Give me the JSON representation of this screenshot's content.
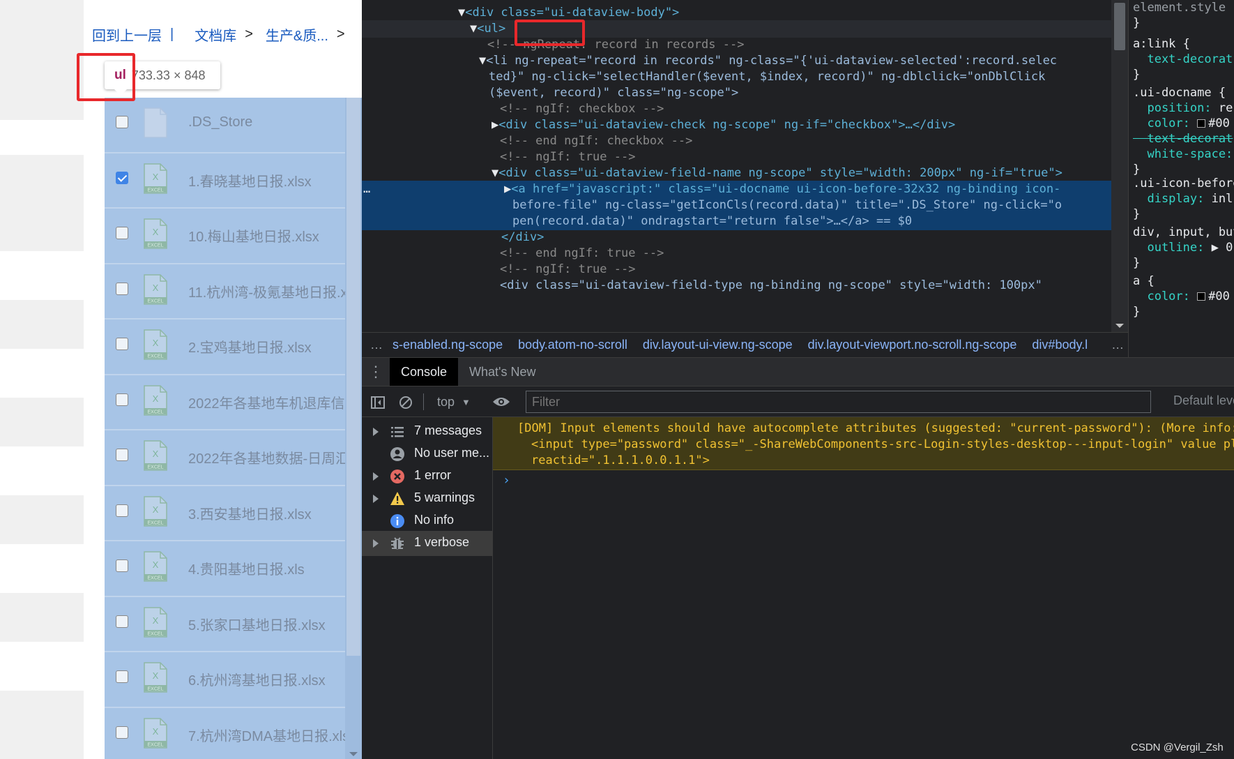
{
  "left_page": {
    "breadcrumb": {
      "back": "回到上一层",
      "pipe": "|",
      "root": "文档库",
      "sep": ">",
      "folder": "生产&质...",
      "sep2": ">"
    },
    "tooltip": {
      "tag": "ul",
      "size": "733.33 × 848"
    },
    "files": [
      {
        "name": ".DS_Store",
        "checked": false,
        "icon": "generic-file-icon"
      },
      {
        "name": "1.春晓基地日报.xlsx",
        "checked": true,
        "icon": "excel-file-icon"
      },
      {
        "name": "10.梅山基地日报.xlsx",
        "checked": false,
        "icon": "excel-file-icon"
      },
      {
        "name": "11.杭州湾-极氪基地日报.x",
        "checked": false,
        "icon": "excel-file-icon"
      },
      {
        "name": "2.宝鸡基地日报.xlsx",
        "checked": false,
        "icon": "excel-file-icon"
      },
      {
        "name": "2022年各基地车机退库信.",
        "checked": false,
        "icon": "excel-file-icon"
      },
      {
        "name": "2022年各基地数据-日周汇",
        "checked": false,
        "icon": "excel-file-icon"
      },
      {
        "name": "3.西安基地日报.xlsx",
        "checked": false,
        "icon": "excel-file-icon"
      },
      {
        "name": "4.贵阳基地日报.xls",
        "checked": false,
        "icon": "excel-file-icon"
      },
      {
        "name": "5.张家口基地日报.xlsx",
        "checked": false,
        "icon": "excel-file-icon"
      },
      {
        "name": "6.杭州湾基地日报.xlsx",
        "checked": false,
        "icon": "excel-file-icon"
      },
      {
        "name": "7.杭州湾DMA基地日报.xls",
        "checked": false,
        "icon": "excel-file-icon"
      }
    ],
    "excel_label": "EXCEL",
    "excel_letter": "X"
  },
  "elements": {
    "l0": [
      "▼",
      "<div class=\"ui-dataview-body\">"
    ],
    "l1": [
      "▼",
      "<ul>"
    ],
    "l2": "<!-- ngRepeat: record in records -->",
    "l3": [
      "▼",
      "<li ng-repeat=\"record in records\" ng-class=\"{'ui-dataview-selected':record.selec"
    ],
    "l4": "ted}\" ng-click=\"selectHandler($event, $index, record)\" ng-dblclick=\"onDblClick",
    "l5": "($event, record)\" class=\"ng-scope\">",
    "l6": "<!-- ngIf: checkbox -->",
    "l7": [
      "▶",
      "<div class=\"ui-dataview-check ng-scope\" ng-if=\"checkbox\">…</div>"
    ],
    "l8": "<!-- end ngIf: checkbox -->",
    "l9": "<!-- ngIf: true -->",
    "l10": [
      "▼",
      "<div class=\"ui-dataview-field-name ng-scope\" style=\"width: 200px\" ng-if=\"true\">"
    ],
    "l11": [
      "▶",
      "<a href=\"javascript:\" class=\"ui-docname ui-icon-before-32x32 ng-binding icon-"
    ],
    "l12": "before-file\" ng-class=\"getIconCls(record.data)\" title=\".DS_Store\" ng-click=\"o",
    "l13": "pen(record.data)\" ondragstart=\"return false\">…</a> == $0",
    "l14": "</div>",
    "l15": "<!-- end ngIf: true -->",
    "l16": "<!-- ngIf: true -->",
    "l17": "<div class=\"ui-dataview-field-type ng-binding ng-scope\" style=\"width: 100px\"",
    "gutter": "…"
  },
  "styles": [
    "element.style {",
    "}",
    "a:link {",
    "  text-decorat",
    "}",
    ".ui-docname {",
    "  position: re",
    "  color: #00",
    "  text-decorat",
    "  white-space:",
    "}",
    ".ui-icon-before",
    "  display: inl",
    "}",
    "div, input, but",
    "  outline: ▶ 0;",
    "}",
    "a {",
    "  color: #00",
    "}"
  ],
  "dom_breadcrumbs": {
    "lead": "…",
    "items": [
      "s-enabled.ng-scope",
      "body.atom-no-scroll",
      "div.layout-ui-view.ng-scope",
      "div.layout-viewport.no-scroll.ng-scope",
      "div#body.l"
    ],
    "tail": "…"
  },
  "drawer": {
    "tabs": [
      "Console",
      "What's New"
    ],
    "kebab": "⋮"
  },
  "console_toolbar": {
    "context": "top",
    "context_caret": "▼",
    "filter_placeholder": "Filter",
    "default_levels": "Default leve"
  },
  "sidebar": [
    {
      "label": "7 messages",
      "icon": "list-icon",
      "expand": true
    },
    {
      "label": "No user me...",
      "icon": "user-icon",
      "expand": false
    },
    {
      "label": "1 error",
      "icon": "error-icon",
      "expand": true
    },
    {
      "label": "5 warnings",
      "icon": "warning-icon",
      "expand": true
    },
    {
      "label": "No info",
      "icon": "info-icon",
      "expand": false
    },
    {
      "label": "1 verbose",
      "icon": "bug-icon",
      "expand": true,
      "selected": true
    }
  ],
  "console": {
    "warn1": "[DOM] Input elements should have autocomplete attributes (suggested: \"current-password\"): (More info: ht",
    "warn2": "<input type=\"password\" class=\"_-ShareWebComponents-src-Login-styles-desktop---input-login\" value place",
    "warn3": "reactid=\".1.1.1.0.0.1.1\">",
    "prompt": "›"
  },
  "watermark": "CSDN @Vergil_Zsh",
  "colors": {
    "selection_overlay": "#a7c4e6",
    "devtools_bg": "#202124",
    "highlight_row": "#0f3e6e",
    "redbox": "#e8282b",
    "warning_bg": "#413b16"
  }
}
